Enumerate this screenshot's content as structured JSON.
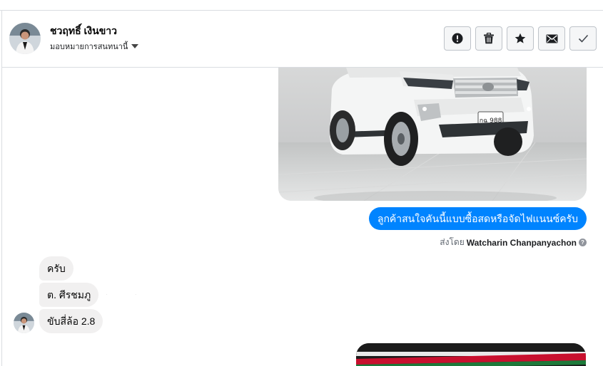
{
  "header": {
    "contact_name": "ชวฤทธิ์ เงินขาว",
    "assign_label": "มอบหมายการสนทนานี้",
    "actions": [
      {
        "name": "spam-button",
        "icon": "alert-circle-icon"
      },
      {
        "name": "delete-button",
        "icon": "trash-icon"
      },
      {
        "name": "star-button",
        "icon": "star-icon"
      },
      {
        "name": "mark-unread-button",
        "icon": "envelope-icon"
      },
      {
        "name": "mark-done-button",
        "icon": "check-icon"
      }
    ]
  },
  "messages": {
    "outgoing_photo": {
      "icon": "car-photo",
      "plate_text": "กฉ 988"
    },
    "outgoing_text": "ลูกค้าสนใจคันนี้แบบซื้อสดหรือจัดไฟแนนซ์ครับ",
    "sent_by_prefix": "ส่งโดย",
    "sent_by_name": "Watcharin Chanpanyachon",
    "incoming": [
      "ครับ",
      "ต. ศีรชมภู",
      "ขับสี่ล้อ   2.8"
    ],
    "outgoing_photo_2": {
      "icon": "banner-photo"
    }
  },
  "colors": {
    "accent": "#0084ff",
    "incoming_bubble": "#f1f0f0",
    "border": "#dadde1"
  }
}
